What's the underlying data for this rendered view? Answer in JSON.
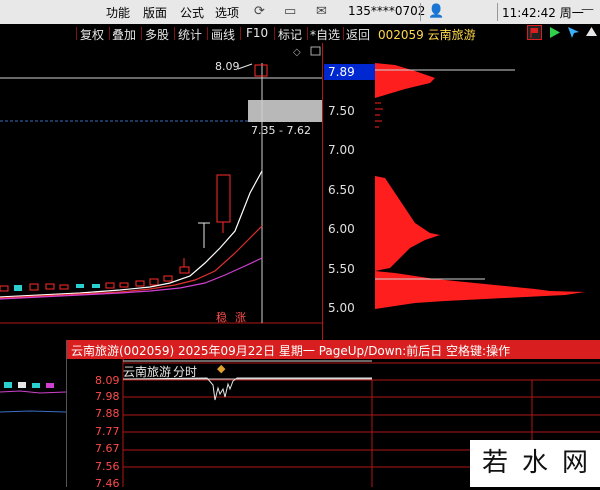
{
  "menu": {
    "items": [
      "功能",
      "版面",
      "公式",
      "选项"
    ],
    "phone": "135****0702",
    "clock": "11:42:42 周一"
  },
  "toolbar": {
    "items": [
      "复权",
      "叠加",
      "多股",
      "统计",
      "画线",
      "F10",
      "标记",
      "*自选",
      "返回"
    ],
    "stock_code": "002059",
    "stock_name": "云南旅游"
  },
  "chart": {
    "y_ticks": [
      "7.50",
      "7.00",
      "6.50",
      "6.00",
      "5.50",
      "5.00"
    ],
    "current_price": "7.89",
    "peak_label": "8.09",
    "range_label": "7.35 - 7.62",
    "badge_labels": [
      "稳",
      "涨"
    ],
    "colors": {
      "up": "#ff2a2a",
      "down": "#2ad0d0",
      "ma5": "#ffffff",
      "ma10": "#e03030",
      "ma20": "#d040d0",
      "axis": "#b01616"
    }
  },
  "popup": {
    "title": "云南旅游(002059) 2025年09月22日 星期一 PageUp/Down:前后日 空格键:操作",
    "stock_name": "云南旅游",
    "view_label": "分时",
    "price_ticks": [
      "8.09",
      "7.98",
      "7.88",
      "7.77",
      "7.67",
      "7.56",
      "7.46"
    ]
  },
  "watermark": {
    "chars": [
      "若",
      "水",
      "网"
    ]
  }
}
